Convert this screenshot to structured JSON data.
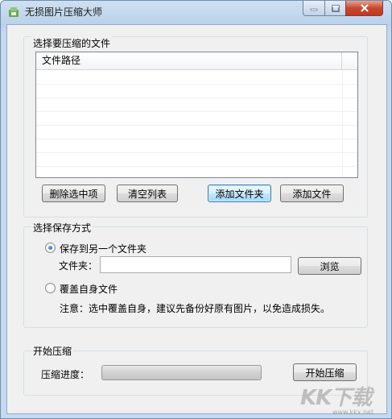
{
  "window": {
    "title": "无损图片压缩大师"
  },
  "file_group": {
    "title": "选择要压缩的文件",
    "list_column": "文件路径",
    "rows": [],
    "buttons": {
      "delete_selected": "删除选中项",
      "clear_list": "清空列表",
      "add_folder": "添加文件夹",
      "add_file": "添加文件"
    }
  },
  "save_group": {
    "title": "选择保存方式",
    "option_other_folder": "保存到另一个文件夹",
    "option_other_folder_selected": true,
    "folder_label": "文件夹：",
    "folder_value": "",
    "browse_button": "浏览",
    "option_overwrite": "覆盖自身文件",
    "option_overwrite_selected": false,
    "note": "注意：选中覆盖自身，建议先备份好原有图片，以免造成损失。"
  },
  "compress_group": {
    "title": "开始压缩",
    "progress_label": "压缩进度：",
    "progress_value": 0,
    "start_button": "开始压缩"
  },
  "watermark": {
    "text": "KK下载",
    "url": "www.kkx.net"
  },
  "icons": [
    "app-icon",
    "minimize-icon",
    "maximize-icon",
    "close-icon"
  ]
}
